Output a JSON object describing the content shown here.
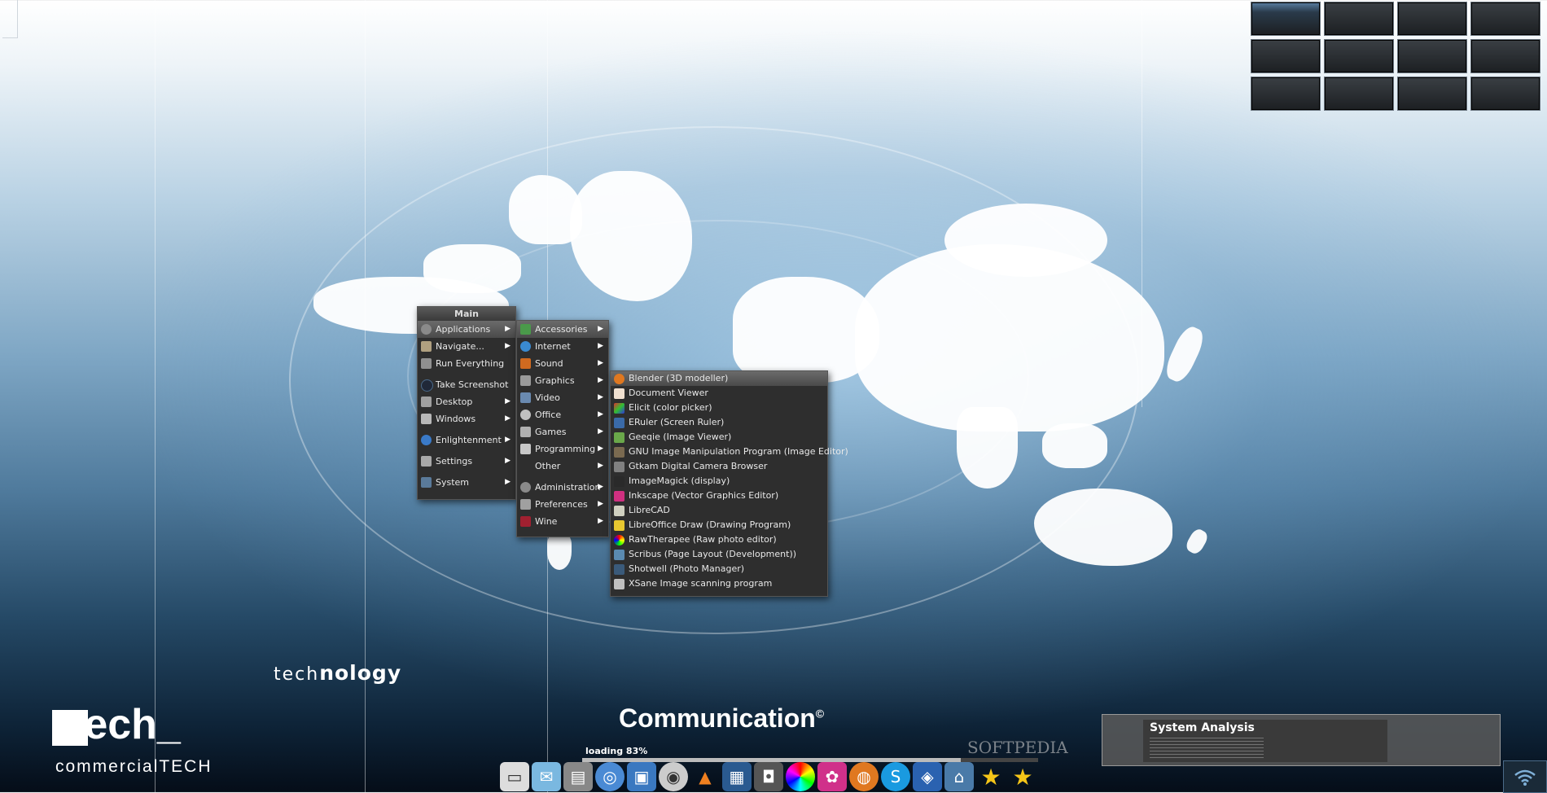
{
  "desktop": {
    "brand_word_light": "tech",
    "brand_word_bold": "nology",
    "logo_main": "tech_",
    "logo_sub": "commercialTECH",
    "communication": "Communication",
    "communication_mark": "©",
    "loading": "loading 83%",
    "watermark": "SOFTPEDIA",
    "system_analysis_title": "System Analysis"
  },
  "pager": {
    "rows": 3,
    "cols": 4,
    "active_index": 0
  },
  "main_menu": {
    "title": "Main",
    "items": [
      {
        "label": "Applications",
        "icon": "applications-icon",
        "submenu": true,
        "highlight": true
      },
      {
        "label": "Navigate...",
        "icon": "navigate-icon",
        "submenu": true
      },
      {
        "label": "Run Everything",
        "icon": "run-everything-icon",
        "submenu": false
      },
      {
        "label": "Take Screenshot",
        "icon": "camera-icon",
        "submenu": false
      },
      {
        "label": "Desktop",
        "icon": "desktop-icon",
        "submenu": true
      },
      {
        "label": "Windows",
        "icon": "windows-icon",
        "submenu": true
      },
      {
        "label": "Enlightenment",
        "icon": "enlightenment-icon",
        "submenu": true
      },
      {
        "label": "Settings",
        "icon": "settings-icon",
        "submenu": true
      },
      {
        "label": "System",
        "icon": "system-icon",
        "submenu": true
      }
    ]
  },
  "apps_menu": {
    "items": [
      {
        "label": "Accessories",
        "icon": "accessories-icon",
        "highlight": true
      },
      {
        "label": "Internet",
        "icon": "internet-icon"
      },
      {
        "label": "Sound",
        "icon": "sound-icon"
      },
      {
        "label": "Graphics",
        "icon": "graphics-icon"
      },
      {
        "label": "Video",
        "icon": "video-icon"
      },
      {
        "label": "Office",
        "icon": "office-icon"
      },
      {
        "label": "Games",
        "icon": "games-icon"
      },
      {
        "label": "Programming",
        "icon": "programming-icon"
      },
      {
        "label": "Other",
        "icon": ""
      },
      {
        "label": "Administration",
        "icon": "administration-icon"
      },
      {
        "label": "Preferences",
        "icon": "preferences-icon"
      },
      {
        "label": "Wine",
        "icon": "wine-icon"
      }
    ]
  },
  "graphics_menu": {
    "items": [
      "Blender (3D modeller)",
      "Document Viewer",
      "Elicit (color picker)",
      "ERuler (Screen Ruler)",
      "Geeqie (Image Viewer)",
      "GNU Image Manipulation Program (Image Editor)",
      "Gtkam Digital Camera Browser",
      "ImageMagick (display)",
      "Inkscape (Vector Graphics Editor)",
      "LibreCAD",
      "LibreOffice Draw (Drawing Program)",
      "RawTherapee (Raw photo editor)",
      "Scribus (Page Layout (Development))",
      "Shotwell (Photo Manager)",
      "XSane Image scanning program"
    ]
  },
  "colors": {
    "menu_bg": "#2e2e2e",
    "menu_highlight": "#5a5a5a",
    "accent": "#7fb0d8"
  }
}
